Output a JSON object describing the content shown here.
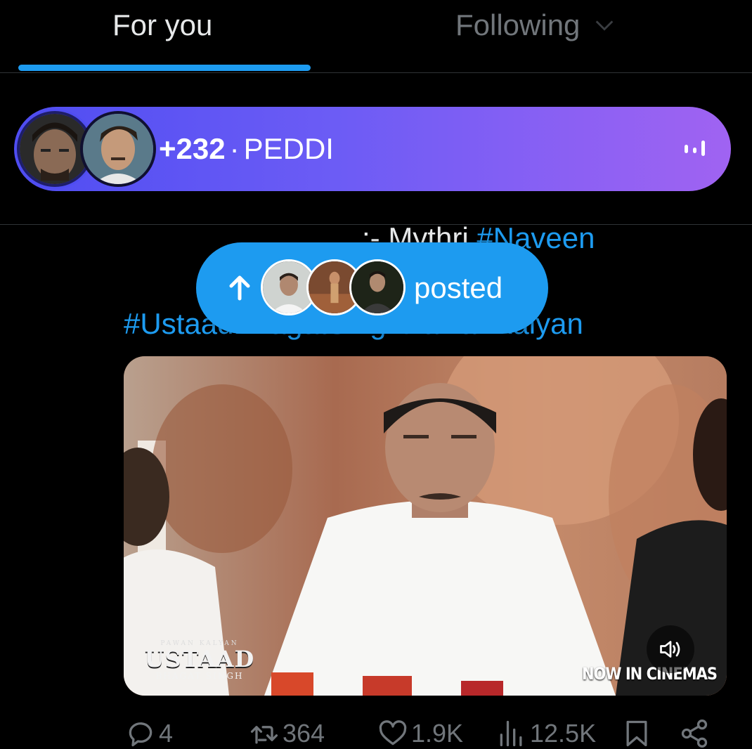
{
  "tabs": {
    "for_you": "For you",
    "following": "Following"
  },
  "space": {
    "count": "+232",
    "separator": "·",
    "title": "PEDDI"
  },
  "tweet": {
    "line1_prefix": ":- Mythri",
    "line1_hashtag": "#Naveen",
    "line3": "#UstaadBhagatSinghPawanKalyan"
  },
  "posted_pill": {
    "label": "posted"
  },
  "media": {
    "logo_top": "PAWAN KALYAN",
    "logo_main": "USTAAD",
    "logo_sub": "BHAGAT SINGH",
    "badge": "NOW IN CINEMAS"
  },
  "actions": {
    "replies": "4",
    "reposts": "364",
    "likes": "1.9K",
    "views": "12.5K"
  },
  "colors": {
    "accent": "#1d9bf0",
    "space_gradient_start": "#4f4df2",
    "space_gradient_end": "#a063f2",
    "muted_text": "#71767b"
  }
}
